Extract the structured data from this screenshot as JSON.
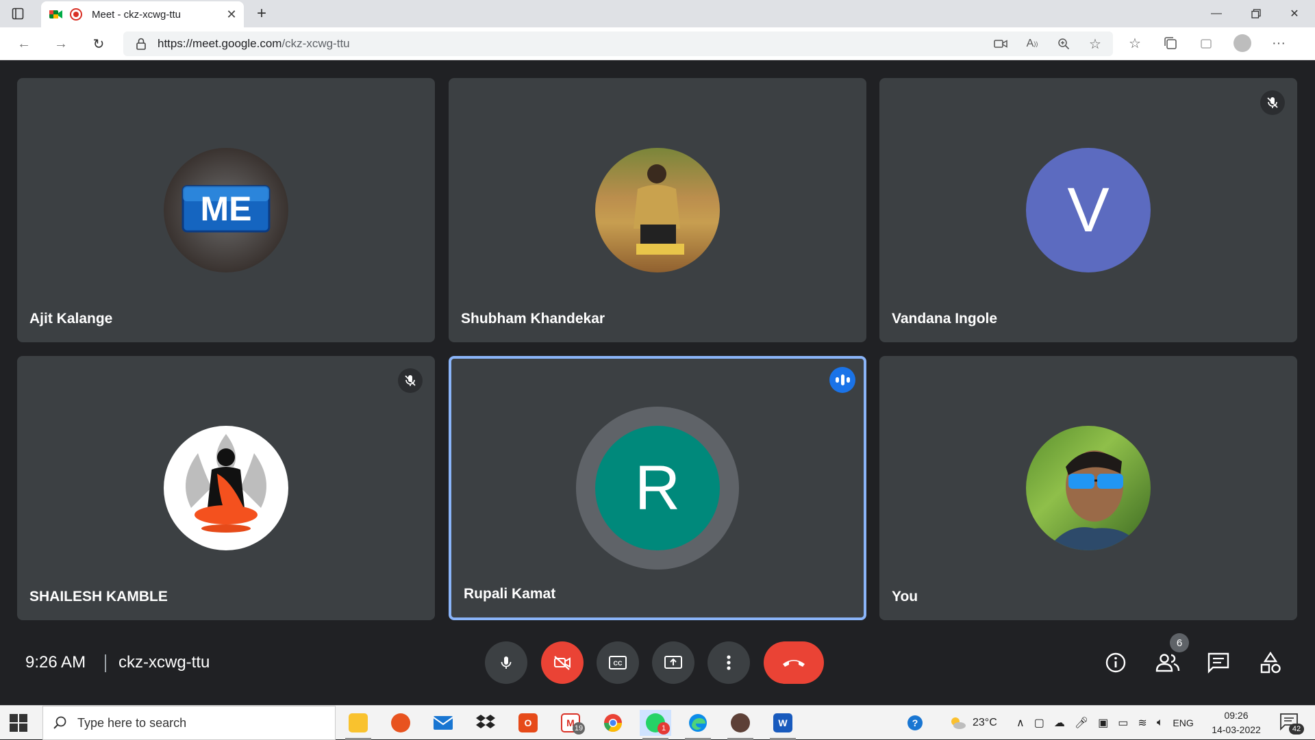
{
  "browser": {
    "tab_title": "Meet - ckz-xcwg-ttu",
    "url_host": "https://meet.google.com",
    "url_path": "/ckz-xcwg-ttu"
  },
  "participants": [
    {
      "name": "Ajit Kalange",
      "avatar": "ME logo",
      "muted": false
    },
    {
      "name": "Shubham Khandekar",
      "avatar": "photo",
      "muted": false
    },
    {
      "name": "Vandana Ingole",
      "avatar_letter": "V",
      "avatar_color": "#5c6bc0",
      "muted": true
    },
    {
      "name": "SHAILESH KAMBLE",
      "avatar": "buddha logo",
      "muted": true
    },
    {
      "name": "Rupali Kamat",
      "avatar_letter": "R",
      "avatar_color": "#00897b",
      "speaking": true
    },
    {
      "name": "You",
      "avatar": "photo",
      "muted": false
    }
  ],
  "logo_text": {
    "me": "ME"
  },
  "meeting": {
    "time": "9:26 AM",
    "code": "ckz-xcwg-ttu",
    "participant_count": "6"
  },
  "taskbar": {
    "search_placeholder": "Type here to search",
    "gmail_badge": "19",
    "whatsapp_badge": "1",
    "word_label": "W",
    "office_label": "O",
    "weather": "23°C",
    "lang": "ENG",
    "time": "09:26",
    "date": "14-03-2022",
    "notifications": "42"
  },
  "colors": {
    "meet_bg": "#202124",
    "tile_bg": "#3c4043",
    "end_call": "#ea4335",
    "speaking_border": "#8ab4f8"
  }
}
